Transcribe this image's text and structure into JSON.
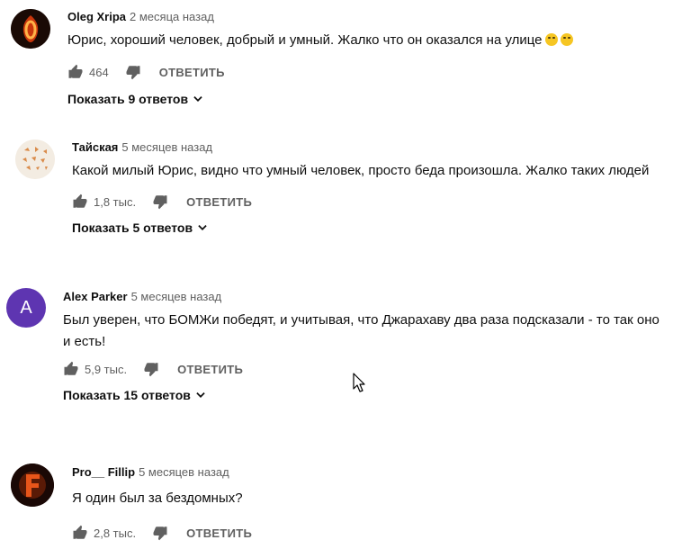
{
  "comments": [
    {
      "author": "Oleg Xripa",
      "time": "2 месяца назад",
      "text": "Юрис, хороший человек, добрый и умный. Жалко что он оказался на улице",
      "emojis": [
        "sad-face-emoji",
        "crying-face-emoji"
      ],
      "likes": "464",
      "reply_label": "ОТВЕТИТЬ",
      "replies_label": "Показать 9 ответов",
      "avatar": {
        "type": "flame-letter",
        "letter": "O",
        "bg": "#1a0a05",
        "fg": "#e8671c"
      }
    },
    {
      "author": "Тайская",
      "time": "5 месяцев назад",
      "text": "Какой милый Юрис, видно что умный человек, просто беда произошла. Жалко таких людей",
      "likes": "1,8 тыс.",
      "reply_label": "ОТВЕТИТЬ",
      "replies_label": "Показать 5 ответов",
      "avatar": {
        "type": "pattern",
        "bg": "#f3ece2",
        "fg": "#d98b4a"
      }
    },
    {
      "author": "Alex Parker",
      "time": "5 месяцев назад",
      "text_line1": "Был уверен, что БОМЖи победят, и учитывая, что Джарахаву два раза подсказали - то так оно",
      "text_line2": "и есть!",
      "likes": "5,9 тыс.",
      "reply_label": "ОТВЕТИТЬ",
      "replies_label": "Показать 15 ответов",
      "avatar": {
        "type": "letter",
        "letter": "A",
        "bg": "#5e35b1",
        "fg": "#ffffff"
      }
    },
    {
      "author": "Pro__ Fillip",
      "time": "5 месяцев назад",
      "text": "Я один был за бездомных?",
      "likes": "2,8 тыс.",
      "reply_label": "ОТВЕТИТЬ",
      "avatar": {
        "type": "flame-letter",
        "letter": "F",
        "bg": "#1a0805",
        "fg": "#e04a12"
      }
    }
  ],
  "colors": {
    "text": "#0f0f0f",
    "secondary": "#606060"
  },
  "icons": [
    "thumb-up-icon",
    "thumb-down-icon",
    "chevron-down-icon",
    "mouse-cursor-icon"
  ]
}
